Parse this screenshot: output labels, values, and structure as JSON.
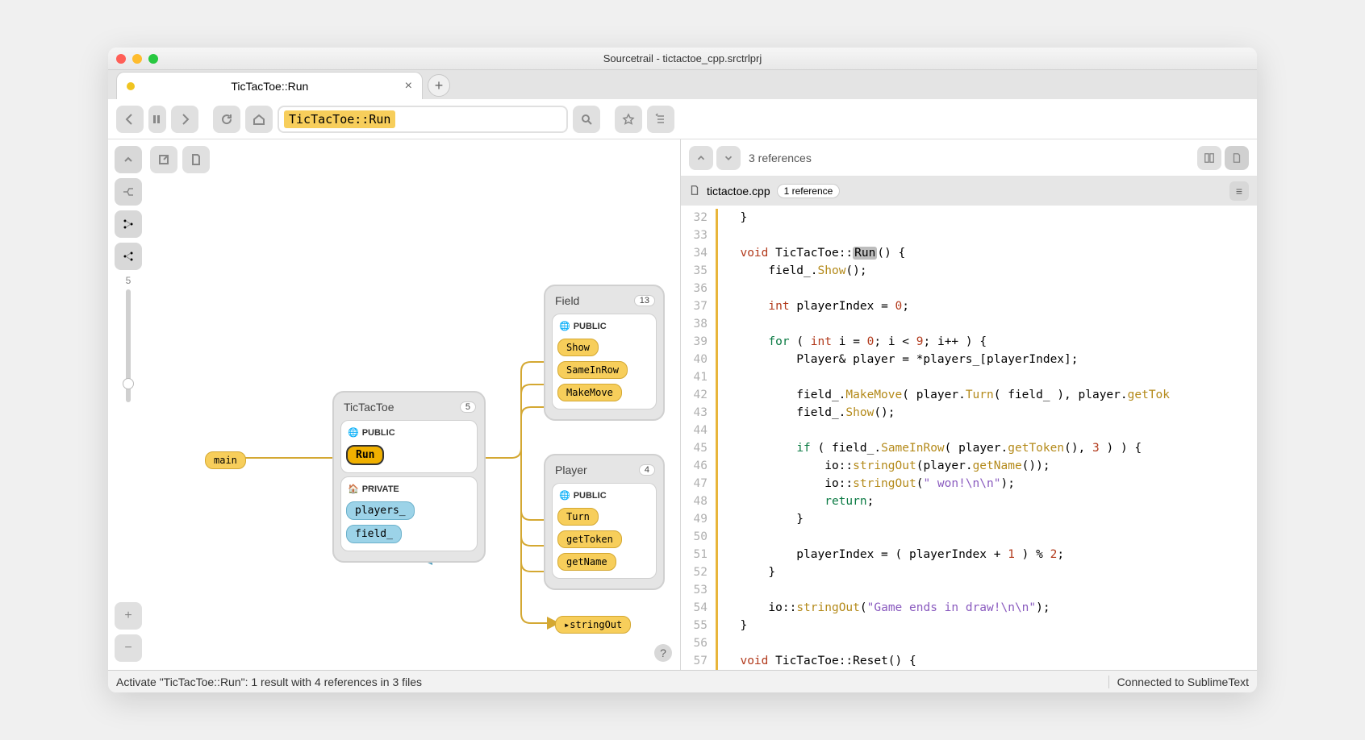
{
  "window": {
    "title": "Sourcetrail - tictactoe_cpp.srctrlprj"
  },
  "tab": {
    "label": "TicTacToe::Run"
  },
  "search": {
    "chip": "TicTacToe::Run"
  },
  "graph": {
    "level": "5",
    "mainNode": {
      "label": "main"
    },
    "ticTacToe": {
      "title": "TicTacToe",
      "count": "5",
      "publicLabel": "PUBLIC",
      "privateLabel": "PRIVATE",
      "run": "Run",
      "players": "players_",
      "field": "field_"
    },
    "field": {
      "title": "Field",
      "count": "13",
      "publicLabel": "PUBLIC",
      "show": "Show",
      "sameInRow": "SameInRow",
      "makeMove": "MakeMove"
    },
    "player": {
      "title": "Player",
      "count": "4",
      "publicLabel": "PUBLIC",
      "turn": "Turn",
      "getToken": "getToken",
      "getName": "getName"
    },
    "stringOut": "stringOut"
  },
  "codeHeader": {
    "refSummary": "3 references"
  },
  "fileHeader": {
    "filename": "tictactoe.cpp",
    "refChip": "1 reference"
  },
  "code": {
    "lines": [
      {
        "n": 32,
        "html": "  }"
      },
      {
        "n": 33,
        "html": ""
      },
      {
        "n": 34,
        "html": "  <span class='type'>void</span> TicTacToe::<span class='hl'>Run</span>() {"
      },
      {
        "n": 35,
        "html": "      field_.<span class='call'>Show</span>();"
      },
      {
        "n": 36,
        "html": ""
      },
      {
        "n": 37,
        "html": "      <span class='type'>int</span> playerIndex = <span class='num'>0</span>;"
      },
      {
        "n": 38,
        "html": ""
      },
      {
        "n": 39,
        "html": "      <span class='kw'>for</span> ( <span class='type'>int</span> i = <span class='num'>0</span>; i &lt; <span class='num'>9</span>; i++ ) {"
      },
      {
        "n": 40,
        "html": "          Player&amp; player = *players_[playerIndex];"
      },
      {
        "n": 41,
        "html": ""
      },
      {
        "n": 42,
        "html": "          field_.<span class='call'>MakeMove</span>( player.<span class='call'>Turn</span>( field_ ), player.<span class='call'>getTok</span>"
      },
      {
        "n": 43,
        "html": "          field_.<span class='call'>Show</span>();"
      },
      {
        "n": 44,
        "html": ""
      },
      {
        "n": 45,
        "html": "          <span class='kw'>if</span> ( field_.<span class='call'>SameInRow</span>( player.<span class='call'>getToken</span>(), <span class='num'>3</span> ) ) {"
      },
      {
        "n": 46,
        "html": "              io::<span class='call'>stringOut</span>(player.<span class='call'>getName</span>());"
      },
      {
        "n": 47,
        "html": "              io::<span class='call'>stringOut</span>(<span class='str'>\" won!\\n\\n\"</span>);"
      },
      {
        "n": 48,
        "html": "              <span class='kw'>return</span>;"
      },
      {
        "n": 49,
        "html": "          }"
      },
      {
        "n": 50,
        "html": ""
      },
      {
        "n": 51,
        "html": "          playerIndex = ( playerIndex + <span class='num'>1</span> ) % <span class='num'>2</span>;"
      },
      {
        "n": 52,
        "html": "      }"
      },
      {
        "n": 53,
        "html": ""
      },
      {
        "n": 54,
        "html": "      io::<span class='call'>stringOut</span>(<span class='str'>\"Game ends in draw!\\n\\n\"</span>);"
      },
      {
        "n": 55,
        "html": "  }"
      },
      {
        "n": 56,
        "html": ""
      },
      {
        "n": 57,
        "html": "  <span class='type'>void</span> TicTacToe::Reset() {"
      }
    ]
  },
  "status": {
    "left": "Activate \"TicTacToe::Run\": 1 result with 4 references in 3 files",
    "right": "Connected to SublimeText"
  }
}
